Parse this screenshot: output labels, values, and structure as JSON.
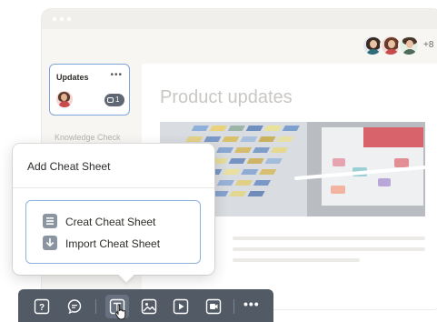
{
  "header": {
    "avatar_overflow_count": "+8"
  },
  "sidebar": {
    "updates_card": {
      "title": "Updates",
      "more_label": "•••",
      "comment_count": "1"
    },
    "items": [
      {
        "label": "Knowledge Check"
      }
    ]
  },
  "main": {
    "page_title": "Product updates"
  },
  "popup": {
    "title": "Add Cheat Sheet",
    "options": [
      {
        "label": "Creat Cheat Sheet",
        "icon": "list-icon"
      },
      {
        "label": "Import Cheat Sheet",
        "icon": "download-icon"
      }
    ]
  },
  "toolbar": {
    "buttons": [
      {
        "icon": "question-icon"
      },
      {
        "icon": "comment-icon"
      },
      {
        "icon": "text-icon",
        "active": true
      },
      {
        "icon": "image-icon"
      },
      {
        "icon": "video-icon"
      },
      {
        "icon": "record-icon"
      }
    ],
    "more_label": "•••"
  },
  "colors": {
    "accent_border": "#8fb1e0",
    "toolbar_bg": "#525a66",
    "pill_bg": "#5e6773"
  }
}
